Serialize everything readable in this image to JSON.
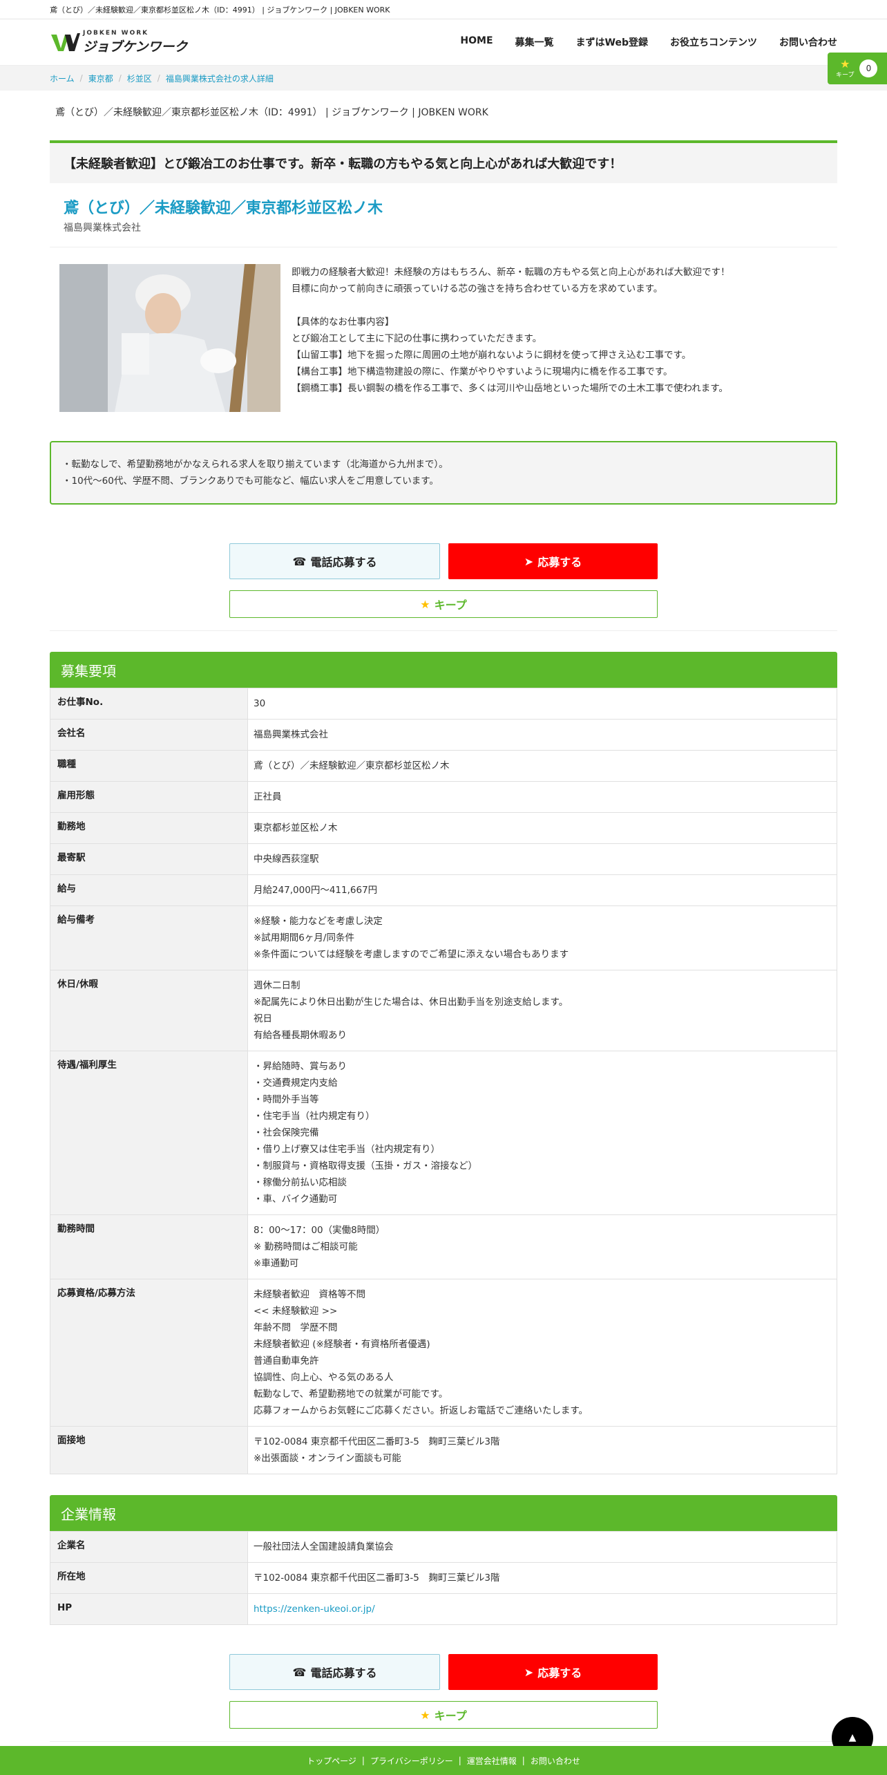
{
  "meta": {
    "topline": "鳶（とび）／未経験歓迎／東京都杉並区松ノ木（ID：4991） | ジョブケンワーク | JOBKEN WORK"
  },
  "header": {
    "logo_small": "JOBKEN WORK",
    "logo_main": "ジョブケンワーク",
    "nav": [
      "HOME",
      "募集一覧",
      "まずはWeb登録",
      "お役立ちコンテンツ",
      "お問い合わせ"
    ],
    "keep_label": "キープ",
    "keep_count": "0"
  },
  "breadcrumb": [
    "ホーム",
    "東京都",
    "杉並区",
    "福島興業株式会社の求人詳細"
  ],
  "page_heading": "鳶（とび）／未経験歓迎／東京都杉並区松ノ木（ID：4991） | ジョブケンワーク | JOBKEN WORK",
  "catch": "【未経験者歓迎】とび鍛冶工のお仕事です。新卒・転職の方もやる気と向上心があれば大歓迎です！",
  "job_title": "鳶（とび）／未経験歓迎／東京都杉並区松ノ木",
  "company": "福島興業株式会社",
  "intro_lines": [
    "即戦力の経験者大歓迎！未経験の方はもちろん、新卒・転職の方もやる気と向上心があれば大歓迎です！",
    "目標に向かって前向きに頑張っていける芯の強さを持ち合わせている方を求めています。",
    "",
    "【具体的なお仕事内容】",
    "とび鍛冶工として主に下記の仕事に携わっていただきます。",
    "【山留工事】地下を掘った際に周囲の土地が崩れないように鋼材を使って押さえ込む工事です。",
    "【構台工事】地下構造物建設の際に、作業がやりやすいように現場内に橋を作る工事です。",
    "【鋼橋工事】長い鋼製の橋を作る工事で、多くは河川や山岳地といった場所での土木工事で使われます。"
  ],
  "notice_lines": [
    "・転勤なしで、希望勤務地がかなえられる求人を取り揃えています（北海道から九州まで）。",
    "・10代〜60代、学歴不問、ブランクありでも可能など、幅広い求人をご用意しています。"
  ],
  "buttons": {
    "tel": "電話応募する",
    "apply": "応募する",
    "keep": "キープ"
  },
  "recruit": {
    "title": "募集要項",
    "rows": [
      {
        "label": "お仕事No.",
        "lines": [
          "30"
        ]
      },
      {
        "label": "会社名",
        "lines": [
          "福島興業株式会社"
        ]
      },
      {
        "label": "職種",
        "lines": [
          "鳶（とび）／未経験歓迎／東京都杉並区松ノ木"
        ]
      },
      {
        "label": "雇用形態",
        "lines": [
          "正社員"
        ]
      },
      {
        "label": "勤務地",
        "lines": [
          "東京都杉並区松ノ木"
        ]
      },
      {
        "label": "最寄駅",
        "lines": [
          "中央線西荻窪駅"
        ]
      },
      {
        "label": "給与",
        "lines": [
          "月給247,000円～411,667円"
        ]
      },
      {
        "label": "給与備考",
        "lines": [
          "※経験・能力などを考慮し決定",
          "※試用期間6ヶ月/同条件",
          "※条件面については経験を考慮しますのでご希望に添えない場合もあります"
        ]
      },
      {
        "label": "休日/休暇",
        "lines": [
          "週休二日制",
          "※配属先により休日出勤が生じた場合は、休日出勤手当を別途支給します。",
          "祝日",
          "有給各種長期休暇あり"
        ]
      },
      {
        "label": "待遇/福利厚生",
        "lines": [
          "・昇給随時、賞与あり",
          "・交通費規定内支給",
          "・時間外手当等",
          "・住宅手当（社内規定有り）",
          "・社会保険完備",
          "・借り上げ寮又は住宅手当（社内規定有り）",
          "・制服貸与・資格取得支援（玉掛・ガス・溶接など）",
          "・稼働分前払い応相談",
          "・車、バイク通勤可"
        ]
      },
      {
        "label": "勤務時間",
        "lines": [
          "8：00～17：00（実働8時間）",
          "※ 勤務時間はご相談可能",
          "※車通勤可"
        ]
      },
      {
        "label": "応募資格/応募方法",
        "lines": [
          "未経験者歓迎　資格等不問",
          "<< 未経験歓迎 >>",
          "年齢不問　学歴不問",
          "未経験者歓迎 (※経験者・有資格所者優遇)",
          "普通自動車免許",
          "協調性、向上心、やる気のある人",
          "転勤なしで、希望勤務地での就業が可能です。",
          "応募フォームからお気軽にご応募ください。折返しお電話でご連絡いたします。"
        ]
      },
      {
        "label": "面接地",
        "lines": [
          "〒102-0084 東京都千代田区二番町3-5　麹町三葉ビル3階",
          "※出張面談・オンライン面談も可能"
        ]
      }
    ]
  },
  "company_info": {
    "title": "企業情報",
    "rows": [
      {
        "label": "企業名",
        "lines": [
          "一般社団法人全国建設請負業協会"
        ]
      },
      {
        "label": "所在地",
        "lines": [
          "〒102-0084 東京都千代田区二番町3-5　麹町三葉ビル3階"
        ]
      },
      {
        "label": "HP",
        "lines": [
          "https://zenken-ukeoi.or.jp/"
        ],
        "link": true
      }
    ]
  },
  "footer": [
    "トップページ",
    "プライバシーポリシー",
    "運営会社情報",
    "お問い合わせ"
  ],
  "totop": "▲",
  "colors": {
    "accent": "#5cb82b",
    "link": "#1a9bc4",
    "apply": "#ff0000"
  }
}
